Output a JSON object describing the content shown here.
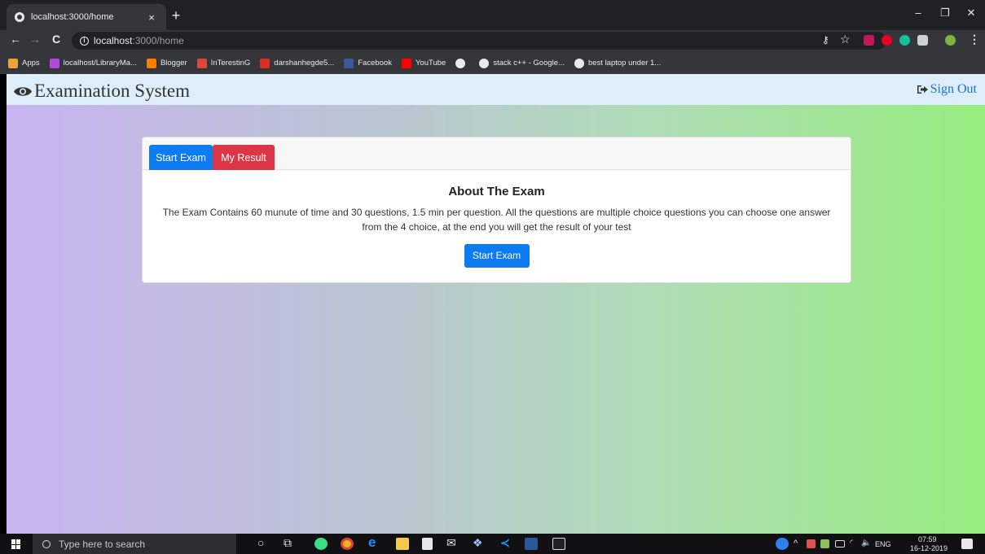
{
  "browser": {
    "tab_title": "localhost:3000/home",
    "tab_close": "×",
    "new_tab": "+",
    "url_host": "localhost",
    "url_path": ":3000/home",
    "win_minimize": "–",
    "win_restore": "❐",
    "win_close": "✕",
    "back": "←",
    "forward": "→",
    "reload": "C",
    "bookmarks": [
      {
        "label": "Apps",
        "icon": "apps-grid-icon",
        "color": "#e8a33d"
      },
      {
        "label": "localhost/LibraryMa...",
        "icon": "site-icon",
        "color": "#b04bd9"
      },
      {
        "label": "Blogger",
        "icon": "blogger-icon",
        "color": "#f57d00"
      },
      {
        "label": "InTerestinG",
        "icon": "folder-icon",
        "color": "#d9463a"
      },
      {
        "label": "darshanhegde5...",
        "icon": "gmail-icon",
        "color": "#d93025"
      },
      {
        "label": "Facebook",
        "icon": "facebook-icon",
        "color": "#3b5998"
      },
      {
        "label": "YouTube",
        "icon": "youtube-icon",
        "color": "#ff0000"
      },
      {
        "label": "",
        "icon": "globe-icon",
        "color": "#e8eaed"
      },
      {
        "label": "stack c++ - Google...",
        "icon": "google-icon",
        "color": "#e8eaed"
      },
      {
        "label": "best laptop under 1...",
        "icon": "google-icon",
        "color": "#e8eaed"
      }
    ]
  },
  "app": {
    "brand": "Examination System",
    "sign_out": "Sign Out",
    "tabs": {
      "start": "Start Exam",
      "result": "My Result"
    },
    "about": {
      "title": "About The Exam",
      "text": "The Exam Contains 60 munute of time and 30 questions, 1.5 min per question. All the questions are multiple choice questions you can choose one answer from the 4 choice, at the end you will get the result of your test",
      "button": "Start Exam"
    },
    "colors": {
      "primary": "#0d7bf2",
      "danger": "#dc3545",
      "gradient_left": "#c8b4f1",
      "gradient_right": "#96ec7e"
    }
  },
  "taskbar": {
    "search_placeholder": "Type here to search",
    "language": "ENG",
    "time": "07:59",
    "date": "16-12-2019"
  }
}
